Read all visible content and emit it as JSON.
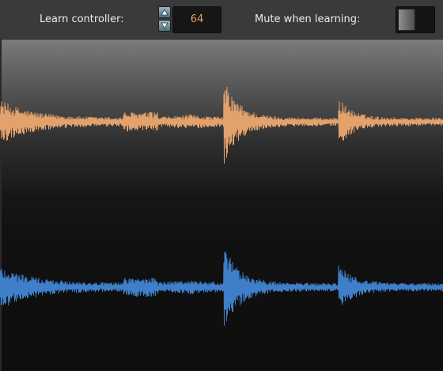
{
  "toolbar": {
    "learn_controller_label": "Learn controller:",
    "learn_controller_value": "64",
    "mute_when_learning_label": "Mute when learning:",
    "mute_when_learning_on": false
  },
  "stepper": {
    "up_icon": "arrow-up-icon",
    "down_icon": "arrow-down-icon"
  },
  "waveform": {
    "channels": [
      {
        "name": "left-channel",
        "color": "#e3a16b"
      },
      {
        "name": "right-channel",
        "color": "#3f7ec8"
      }
    ]
  },
  "colors": {
    "toolbar_bg": "#3a3a3a",
    "value_text": "#e0a467",
    "stepper_button": "#7fa0b0",
    "display_top": "#7b7b7b",
    "display_bottom": "#0e0e0e"
  }
}
